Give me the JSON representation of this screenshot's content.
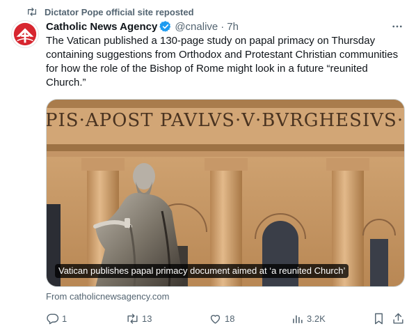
{
  "social_context": {
    "text": "Dictator Pope official site reposted"
  },
  "author": {
    "name": "Catholic News Agency",
    "handle": "@cnalive",
    "separator": "·",
    "time": "7h"
  },
  "tweet": {
    "text": "The Vatican published a 130-page study on papal primacy on Thursday containing suggestions from Orthodox and Protestant Christian communities for how the role of the Bishop of Rome might look in a future “reunited Church.”"
  },
  "card": {
    "image_alt": "Statue of Saint Peter in front of St. Peter's Basilica facade",
    "inscription": "PIS·APOST PAVLVS·V·BVRGHESIVS·ROMAN",
    "headline": "Vatican publishes papal primacy document aimed at ‘a reunited Church’",
    "source": "From catholicnewsagency.com"
  },
  "actions": {
    "replies": "1",
    "reposts": "13",
    "likes": "18",
    "views": "3.2K"
  },
  "colors": {
    "text_primary": "#0f1419",
    "text_secondary": "#536471",
    "verified_blue": "#1d9bf0",
    "brand_red": "#d7262f",
    "stone": "#c99b69"
  },
  "icons": {
    "repost": "repost-icon",
    "verified": "verified-badge-icon",
    "more": "more-icon",
    "reply": "reply-icon",
    "like": "heart-icon",
    "views": "views-icon",
    "bookmark": "bookmark-icon",
    "share": "share-icon"
  }
}
